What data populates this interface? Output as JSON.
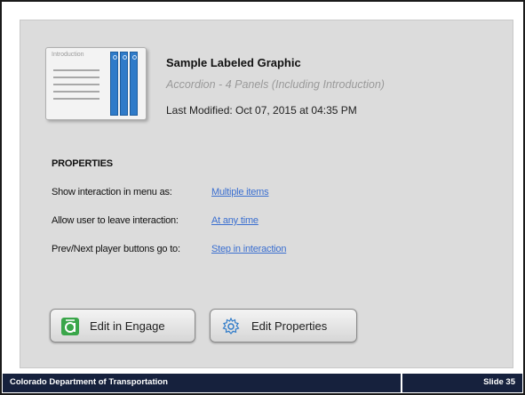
{
  "graphic": {
    "title": "Sample Labeled Graphic",
    "subtitle": "Accordion - 4 Panels (Including Introduction)",
    "modified": "Last Modified: Oct 07, 2015 at 04:35 PM",
    "thumbnail_label": "Introduction"
  },
  "properties": {
    "heading": "PROPERTIES",
    "rows": [
      {
        "label": "Show interaction in menu as:",
        "value": "Multiple items"
      },
      {
        "label": "Allow user to leave interaction:",
        "value": "At any time"
      },
      {
        "label": "Prev/Next player buttons go to:",
        "value": "Step in interaction"
      }
    ]
  },
  "buttons": {
    "edit_engage": "Edit in Engage",
    "edit_properties": "Edit Properties"
  },
  "footer": {
    "org": "Colorado Department of Transportation",
    "slide": "Slide 35"
  },
  "colors": {
    "accent_link": "#3b6fd0",
    "thumb_bar": "#2f7bc9",
    "engage_icon": "#3aa64a",
    "footer_bg": "#16213d"
  }
}
